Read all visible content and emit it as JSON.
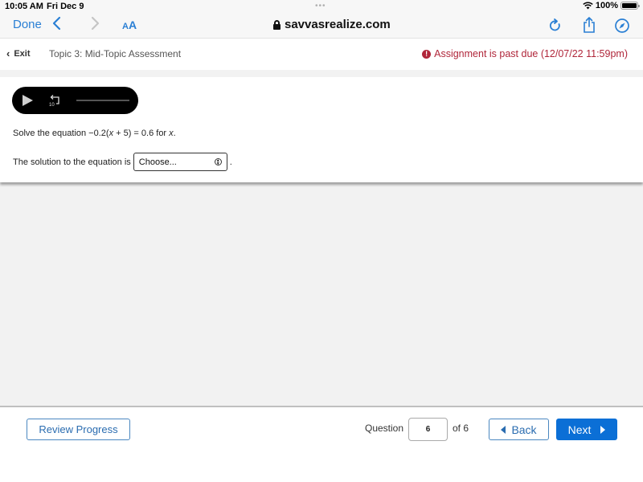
{
  "status_bar": {
    "time": "10:05 AM",
    "date": "Fri Dec 9",
    "dots": "•••",
    "battery_percent": "100%",
    "battery_level": 1.0
  },
  "browser": {
    "done_label": "Done",
    "back_icon": "chevron-left-icon",
    "forward_icon": "chevron-right-icon",
    "text_size_small": "A",
    "text_size_big": "A",
    "url": "savvasrealize.com",
    "accent_color": "#2a7fd4"
  },
  "header": {
    "exit_label": "Exit",
    "title": "Topic 3: Mid-Topic Assessment",
    "past_due_icon": "!",
    "past_due_text": "Assignment is past due (12/07/22 11:59pm)",
    "alert_color": "#b0263a"
  },
  "question": {
    "audio": {
      "rewind_seconds": "10",
      "progress": 0
    },
    "prompt_prefix": "Solve the equation −0.2(",
    "prompt_var1": "x",
    "prompt_middle": " + 5) = 0.6 for ",
    "prompt_var2": "x",
    "prompt_suffix": ".",
    "answer_label": "The solution to the equation is",
    "answer_select_value": "Choose...",
    "answer_period": "."
  },
  "footer": {
    "review_label": "Review Progress",
    "question_label": "Question",
    "current_question": "6",
    "of_label": "of 6",
    "back_label": "Back",
    "next_label": "Next",
    "primary_color": "#0b6fd6"
  }
}
